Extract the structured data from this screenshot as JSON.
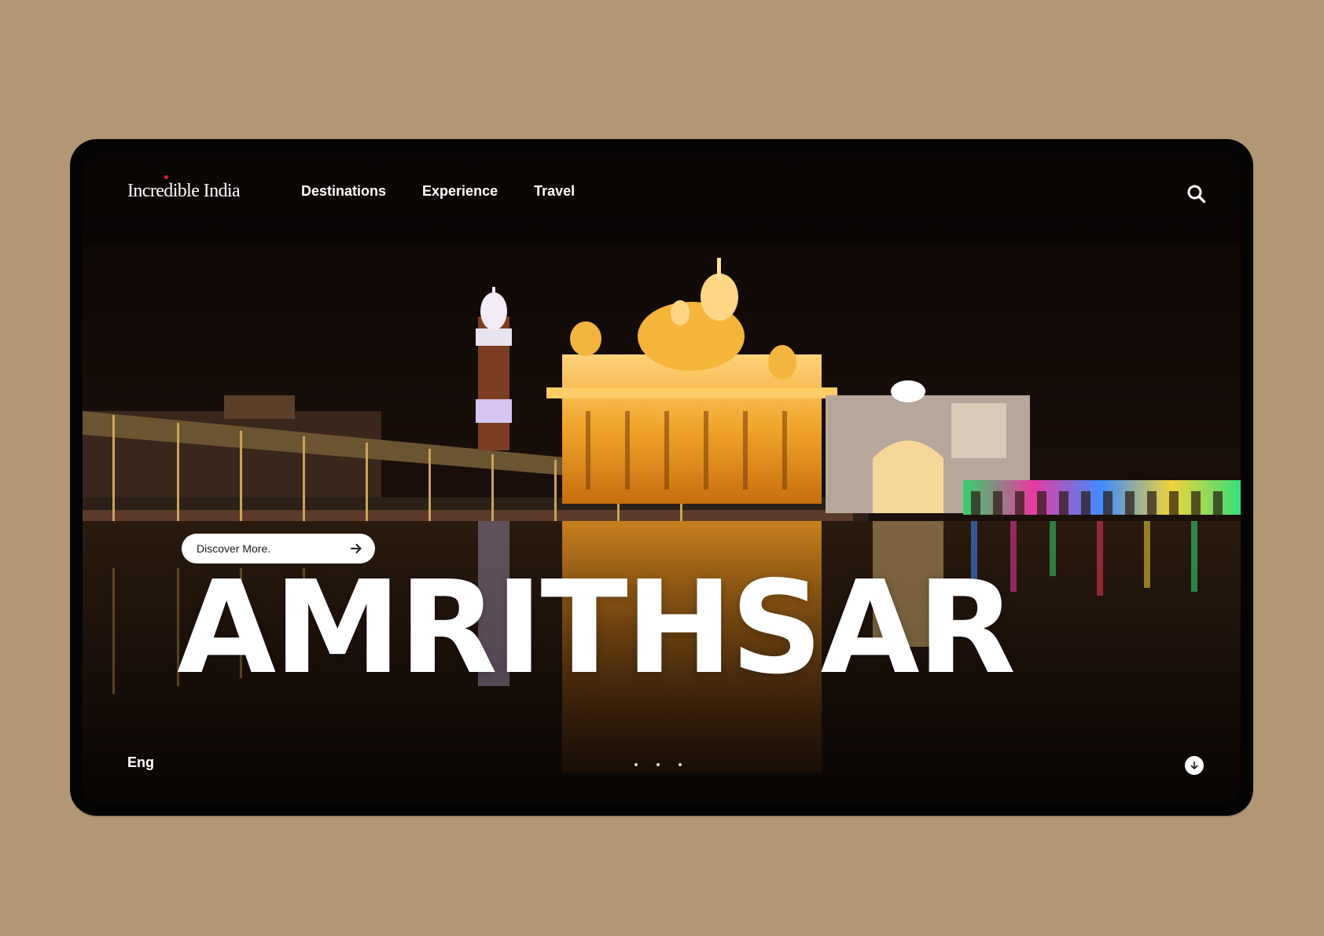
{
  "brand": {
    "logo_text": "Incredible India"
  },
  "nav": {
    "items": [
      {
        "label": "Destinations"
      },
      {
        "label": "Experience"
      },
      {
        "label": "Travel"
      }
    ]
  },
  "header": {
    "search_icon": "search-icon"
  },
  "hero": {
    "cta_label": "Discover More.",
    "cta_icon": "arrow-right-icon",
    "title": "AMRITHSAR",
    "image": "golden-temple-night-photo"
  },
  "footer": {
    "language": "Eng",
    "slides": {
      "count": 3
    },
    "scroll_icon": "arrow-down-icon"
  },
  "colors": {
    "background": "#b39774",
    "frame": "#050404",
    "text": "#ffffff",
    "logo_dot": "#e32026"
  }
}
